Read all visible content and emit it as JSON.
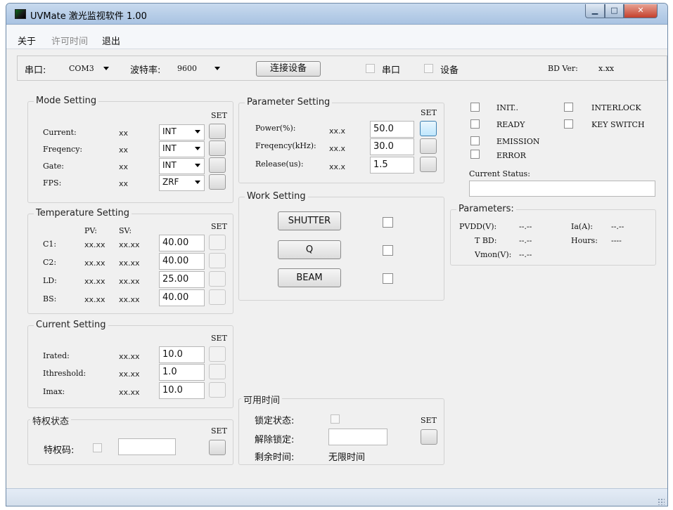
{
  "window": {
    "title": "UVMate 激光监视软件 1.00",
    "minimize_glyph": "▁",
    "maximize_glyph": "□",
    "close_glyph": "✕"
  },
  "menu": {
    "about": "关于",
    "license_time": "许可时间",
    "exit": "退出"
  },
  "connection": {
    "port_label": "串口:",
    "port_value": "COM3",
    "baud_label": "波特率:",
    "baud_value": "9600",
    "connect_button": "连接设备",
    "serial_indicator": "串口",
    "device_indicator": "设备",
    "bd_ver_label": "BD Ver:",
    "bd_ver_value": "x.xx"
  },
  "set_label": "SET",
  "mode_setting": {
    "title": "Mode Setting",
    "rows": [
      {
        "label": "Current:",
        "value": "xx",
        "mode": "INT"
      },
      {
        "label": "Freqency:",
        "value": "xx",
        "mode": "INT"
      },
      {
        "label": "Gate:",
        "value": "xx",
        "mode": "INT"
      },
      {
        "label": "FPS:",
        "value": "xx",
        "mode": "ZRF"
      }
    ]
  },
  "temperature_setting": {
    "title": "Temperature Setting",
    "pv_header": "PV:",
    "sv_header": "SV:",
    "rows": [
      {
        "label": "C1:",
        "pv": "xx.xx",
        "sv": "xx.xx",
        "input": "40.00"
      },
      {
        "label": "C2:",
        "pv": "xx.xx",
        "sv": "xx.xx",
        "input": "40.00"
      },
      {
        "label": "LD:",
        "pv": "xx.xx",
        "sv": "xx.xx",
        "input": "25.00"
      },
      {
        "label": "BS:",
        "pv": "xx.xx",
        "sv": "xx.xx",
        "input": "40.00"
      }
    ]
  },
  "current_setting": {
    "title": "Current Setting",
    "rows": [
      {
        "label": "Irated:",
        "value": "xx.xx",
        "input": "10.0"
      },
      {
        "label": "Ithreshold:",
        "value": "xx.xx",
        "input": "1.0"
      },
      {
        "label": "Imax:",
        "value": "xx.xx",
        "input": "10.0"
      }
    ]
  },
  "privilege": {
    "title": "特权状态",
    "code_label": "特权码:"
  },
  "parameter_setting": {
    "title": "Parameter Setting",
    "rows": [
      {
        "label": "Power(%):",
        "value": "xx.x",
        "input": "50.0"
      },
      {
        "label": "Freqency(kHz):",
        "value": "xx.x",
        "input": "30.0"
      },
      {
        "label": "Release(us):",
        "value": "xx.x",
        "input": "1.5"
      }
    ]
  },
  "work_setting": {
    "title": "Work Setting",
    "shutter": "SHUTTER",
    "q": "Q",
    "beam": "BEAM"
  },
  "available_time": {
    "title": "可用时间",
    "lock_state": "锁定状态:",
    "unlock": "解除锁定:",
    "remaining": "剩余时间:",
    "remaining_value": "无限时间"
  },
  "status_flags": {
    "init": "INIT..",
    "ready": "READY",
    "emission": "EMISSION",
    "error": "ERROR",
    "interlock": "INTERLOCK",
    "key_switch": "KEY SWITCH",
    "current_status_label": "Current Status:"
  },
  "parameters": {
    "title": "Parameters:",
    "pvdd_label": "PVDD(V):",
    "pvdd_value": "--.--",
    "ia_label": "Ia(A):",
    "ia_value": "--.--",
    "tbd_label": "T BD:",
    "tbd_value": "--.--",
    "hours_label": "Hours:",
    "hours_value": "----",
    "vmon_label": "Vmon(V):",
    "vmon_value": "--.--"
  }
}
